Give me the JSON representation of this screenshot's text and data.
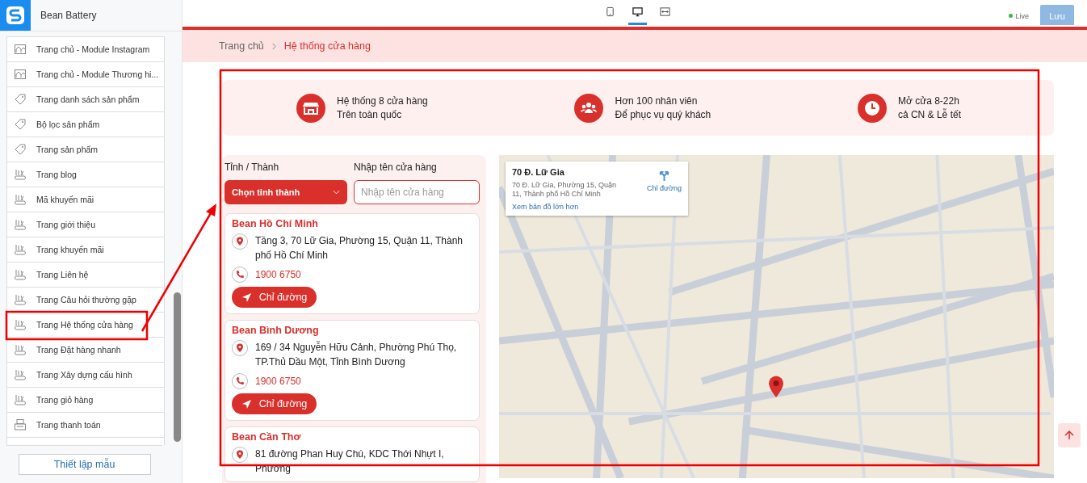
{
  "app": {
    "name": "Bean Battery"
  },
  "sidebar": {
    "items": [
      {
        "label": "Trang chủ - Module Instagram",
        "kind": "home"
      },
      {
        "label": "Trang chủ - Module Thương hi...",
        "kind": "home"
      },
      {
        "label": "Trang danh sách sản phẩm",
        "kind": "tag"
      },
      {
        "label": "Bộ lọc sản phẩm",
        "kind": "tag"
      },
      {
        "label": "Trang sản phẩm",
        "kind": "tag"
      },
      {
        "label": "Trang blog",
        "kind": "page"
      },
      {
        "label": "Mã khuyến mãi",
        "kind": "page"
      },
      {
        "label": "Trang giới thiệu",
        "kind": "page"
      },
      {
        "label": "Trang khuyến mãi",
        "kind": "page"
      },
      {
        "label": "Trang Liên hệ",
        "kind": "page"
      },
      {
        "label": "Trang Câu hỏi thường gặp",
        "kind": "page"
      },
      {
        "label": "Trang Hệ thống cửa hàng",
        "kind": "page"
      },
      {
        "label": "Trang Đặt hàng nhanh",
        "kind": "page"
      },
      {
        "label": "Trang Xây dựng cấu hình",
        "kind": "page"
      },
      {
        "label": "Trang giỏ hàng",
        "kind": "page"
      },
      {
        "label": "Trang thanh toán",
        "kind": "checkout"
      }
    ],
    "footer_button": "Thiết lập mẫu"
  },
  "toolbar": {
    "devices": [
      {
        "kind": "mobile",
        "selected": false
      },
      {
        "kind": "desktop",
        "selected": true
      },
      {
        "kind": "fullwidth",
        "selected": false
      }
    ],
    "status": "Live",
    "save_button": "Lưu"
  },
  "breadcrumb": [
    {
      "label": "Trang chủ",
      "current": false
    },
    {
      "label": "Hệ thống cửa hàng",
      "current": true
    }
  ],
  "features": [
    {
      "kind": "store",
      "title": "Hệ thống 8 cửa hàng",
      "subtitle": "Trên toàn quốc"
    },
    {
      "kind": "staff",
      "title": "Hơn 100 nhân viên",
      "subtitle": "Để phục vụ quý khách"
    },
    {
      "kind": "clock",
      "title": "Mở cửa 8-22h",
      "subtitle": "cả CN & Lễ tết"
    }
  ],
  "filters": {
    "province_label": "Tỉnh / Thành",
    "province_select": "Chọn tỉnh thành",
    "name_label": "Nhập tên cửa hàng",
    "name_placeholder": "Nhập tên cửa hàng"
  },
  "stores": [
    {
      "name": "Bean Hồ Chí Minh",
      "address": "Tầng 3, 70 Lữ Gia, Phường 15, Quận 11, Thành phố Hồ Chí Minh",
      "phone": "1900 6750",
      "button": "Chỉ đường"
    },
    {
      "name": "Bean Bình Dương",
      "address": "169 / 34 Nguyễn Hữu Cảnh, Phường Phú Thọ, TP.Thủ Dầu Một, Tỉnh Bình Dương",
      "phone": "1900 6750",
      "button": "Chỉ đường"
    },
    {
      "name": "Bean Cần Thơ",
      "address": "81 đường Phan Huy Chú, KDC Thới Nhựt I, Phường"
    }
  ],
  "map": {
    "place_title": "70 Đ. Lữ Gia",
    "place_address": "70 Đ. Lữ Gia, Phường 15, Quận 11, Thành phố Hồ Chí Minh",
    "directions": "Chỉ đường",
    "larger_map_link": "Xem bản đồ lớn hơn"
  }
}
